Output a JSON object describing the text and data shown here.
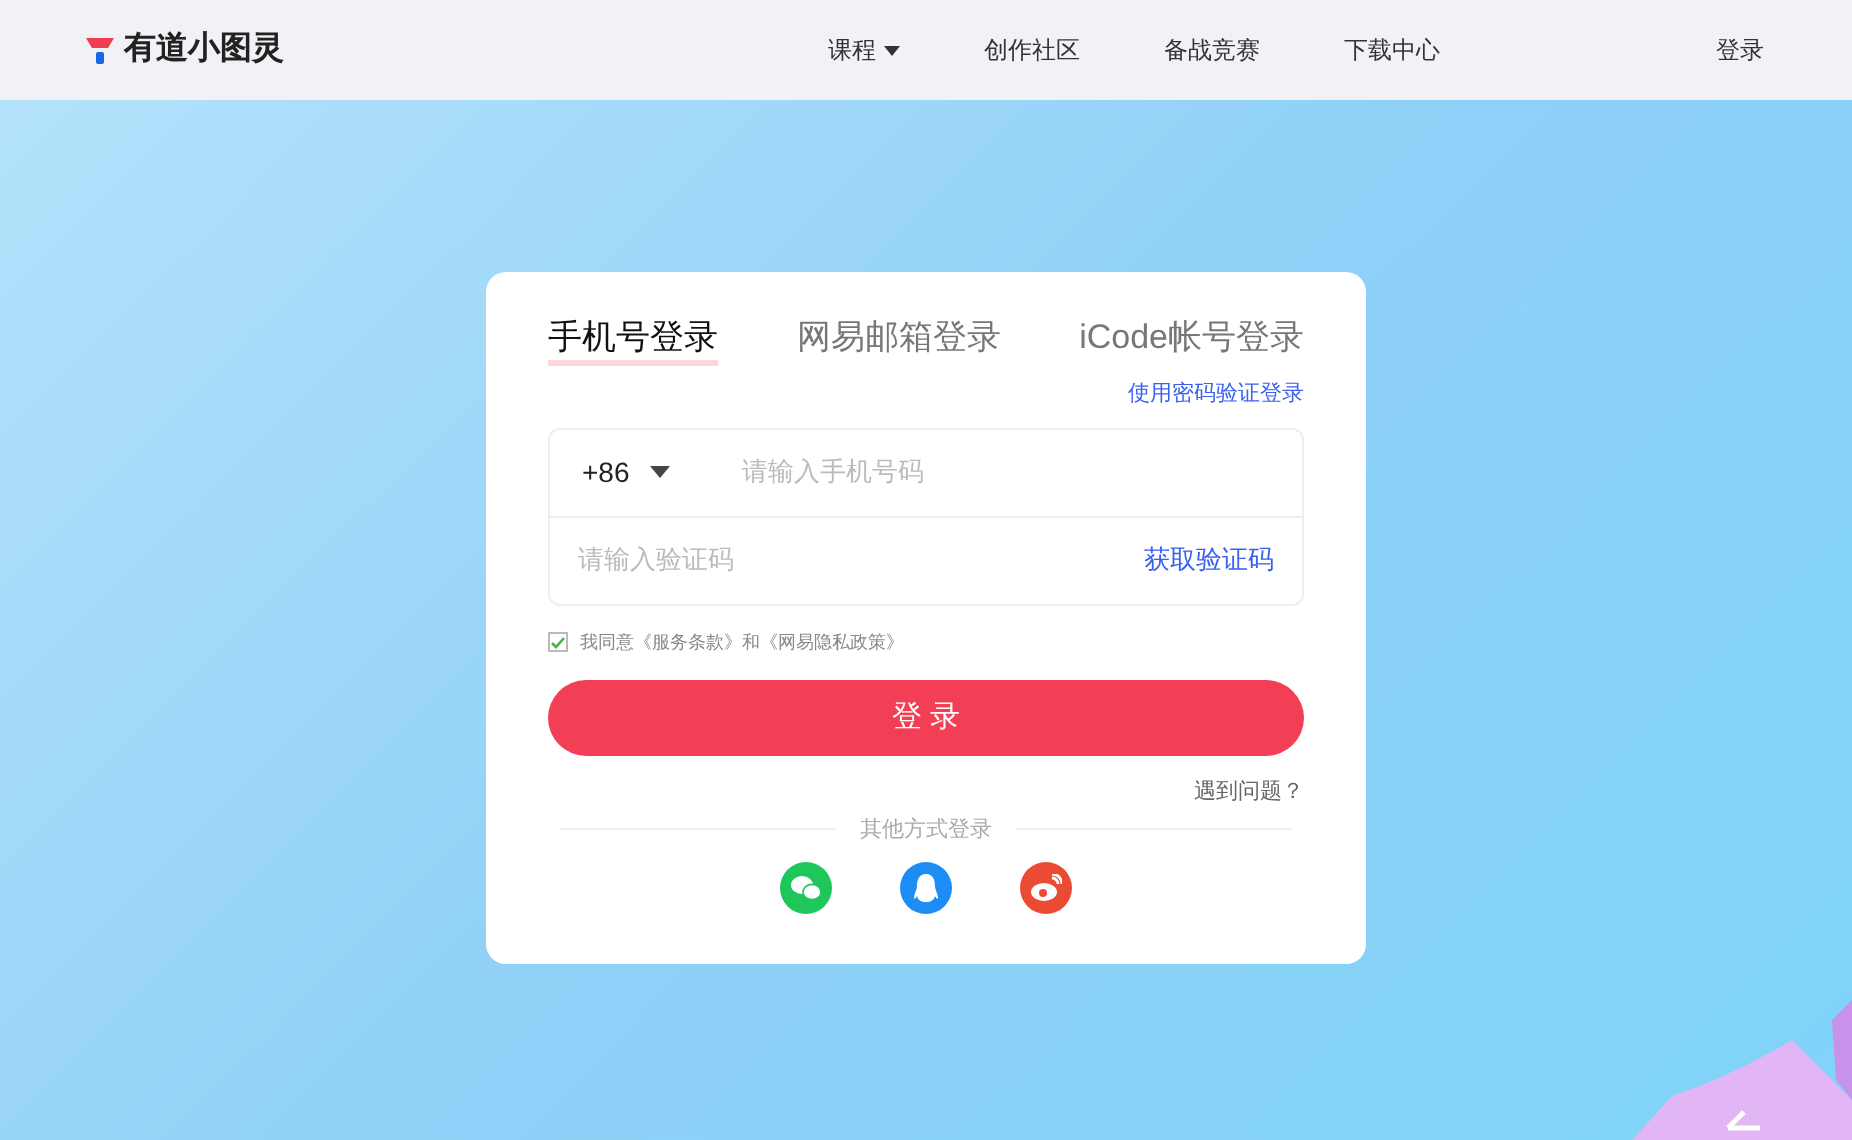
{
  "header": {
    "logo": "有道小图灵",
    "nav": [
      {
        "label": "课程",
        "dropdown": true
      },
      {
        "label": "创作社区",
        "dropdown": false
      },
      {
        "label": "备战竞赛",
        "dropdown": false
      },
      {
        "label": "下载中心",
        "dropdown": false
      }
    ],
    "login": "登录"
  },
  "login_card": {
    "tabs": [
      {
        "label": "手机号登录",
        "selected": true
      },
      {
        "label": "网易邮箱登录",
        "selected": false
      },
      {
        "label": "iCode帐号登录",
        "selected": false
      }
    ],
    "alt_link": "使用密码验证登录",
    "country_code": "+86",
    "phone": {
      "placeholder": "请输入手机号码"
    },
    "code": {
      "placeholder": "请输入验证码"
    },
    "get_code": "获取验证码",
    "agreement": {
      "checked": true,
      "text": "我同意《服务条款》和《网易隐私政策》"
    },
    "submit": "登 录",
    "help": "遇到问题？",
    "other": "其他方式登录",
    "socials": [
      {
        "kind": "wechat",
        "color": "#1fc75a"
      },
      {
        "kind": "qq",
        "color": "#1e8cf5"
      },
      {
        "kind": "weibo",
        "color": "#ec4b33"
      }
    ]
  }
}
